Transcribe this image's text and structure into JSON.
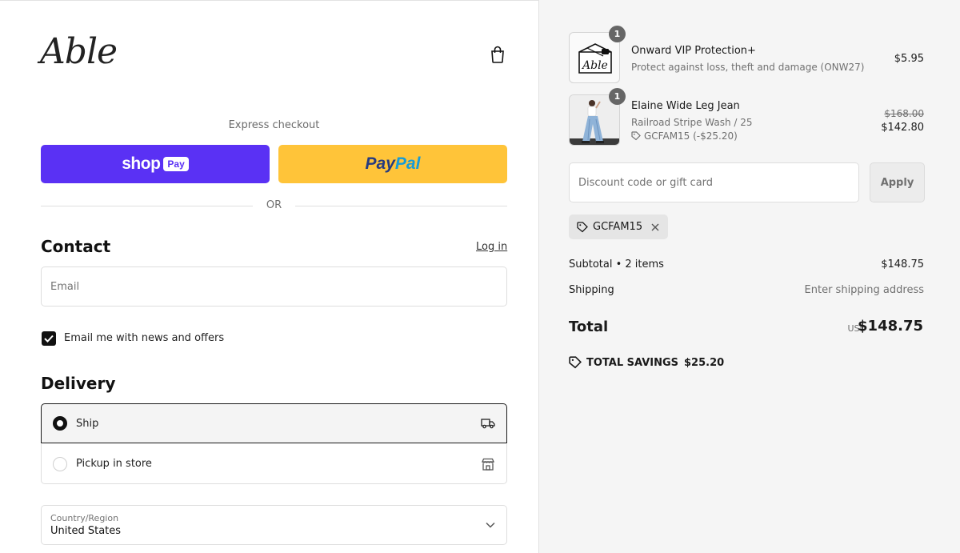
{
  "brand": {
    "logo_text": "Able"
  },
  "express": {
    "label": "Express checkout",
    "shop_pay": {
      "shop": "shop",
      "pay": "Pay"
    },
    "paypal": {
      "part1": "Pay",
      "part2": "Pal"
    },
    "or_text": "OR"
  },
  "contact": {
    "heading": "Contact",
    "login_link": "Log in",
    "email_placeholder": "Email",
    "newsletter_label": "Email me with news and offers",
    "newsletter_checked": true
  },
  "delivery": {
    "heading": "Delivery",
    "options": [
      {
        "label": "Ship",
        "selected": true,
        "icon": "truck-icon"
      },
      {
        "label": "Pickup in store",
        "selected": false,
        "icon": "store-icon"
      }
    ],
    "country_label": "Country/Region",
    "country_value": "United States"
  },
  "cart": {
    "items": [
      {
        "qty": "1",
        "name": "Onward VIP Protection+",
        "subtitle": "Protect against loss, theft and damage (ONW27)",
        "price": "$5.95",
        "thumb_text": "Able"
      },
      {
        "qty": "1",
        "name": "Elaine Wide Leg Jean",
        "variant": "Railroad Stripe Wash / 25",
        "discount": "GCFAM15 (-$25.20)",
        "original_price": "$168.00",
        "price": "$142.80"
      }
    ],
    "discount_placeholder": "Discount code or gift card",
    "apply_label": "Apply",
    "applied_code": "GCFAM15"
  },
  "summary": {
    "subtotal_label": "Subtotal • 2 items",
    "subtotal_value": "$148.75",
    "shipping_label": "Shipping",
    "shipping_value": "Enter shipping address",
    "total_label": "Total",
    "currency": "USD",
    "total_value": "$148.75",
    "savings_label": "TOTAL SAVINGS",
    "savings_value": "$25.20"
  },
  "colors": {
    "shop_pay": "#5a31f4",
    "paypal": "#ffc439",
    "paypal_dark": "#253b80",
    "paypal_light": "#179bd7",
    "summary_bg": "#f5f5f5"
  }
}
